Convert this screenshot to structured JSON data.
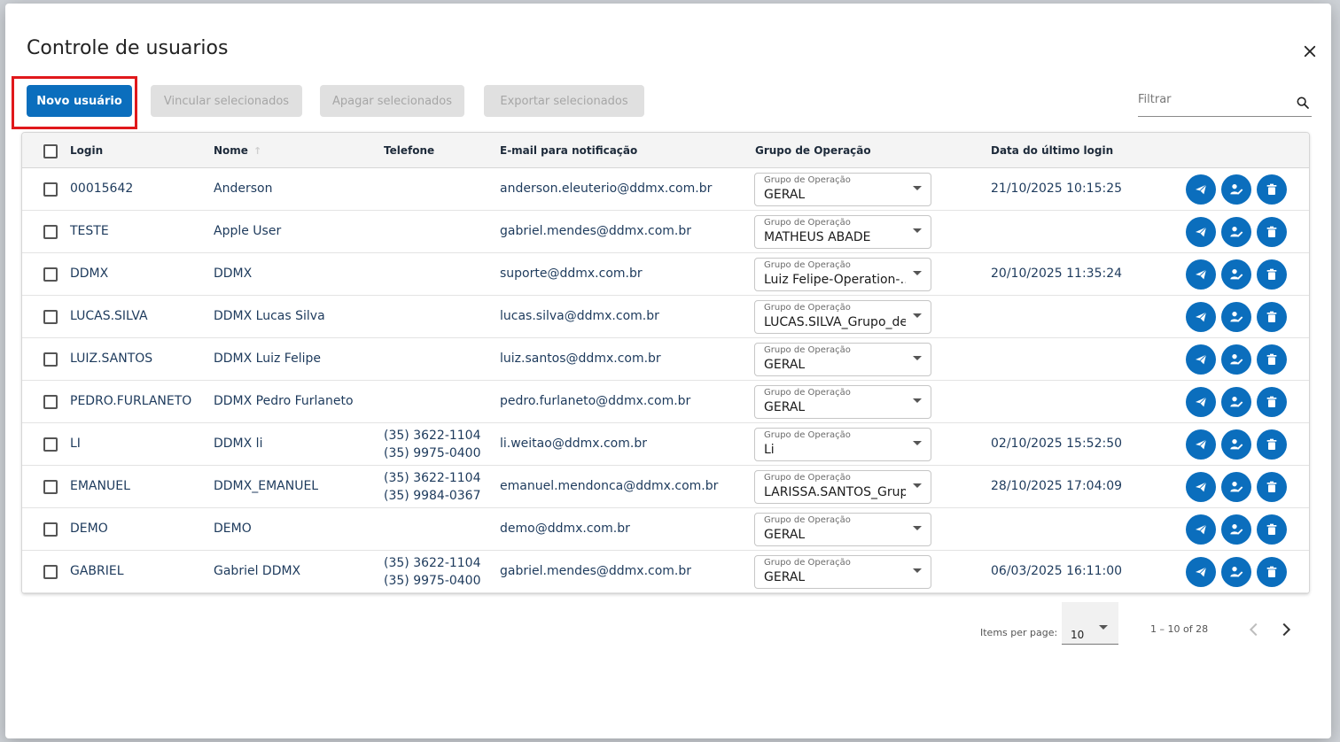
{
  "dialog": {
    "title": "Controle de usuarios"
  },
  "toolbar": {
    "new_user": "Novo usuário",
    "link_selected": "Vincular selecionados",
    "delete_selected": "Apagar selecionados",
    "export_selected": "Exportar selecionados"
  },
  "filter": {
    "placeholder": "Filtrar",
    "value": ""
  },
  "table": {
    "headers": {
      "login": "Login",
      "name": "Nome",
      "phone": "Telefone",
      "email": "E-mail para notificação",
      "group": "Grupo de Operação",
      "last_login": "Data do último login"
    },
    "group_field_label": "Grupo de Operação",
    "rows": [
      {
        "login": "00015642",
        "name": "Anderson",
        "phone1": "",
        "phone2": "",
        "email": "anderson.eleuterio@ddmx.com.br",
        "group": "GERAL",
        "last_login": "21/10/2025 10:15:25"
      },
      {
        "login": "TESTE",
        "name": "Apple User",
        "phone1": "",
        "phone2": "",
        "email": "gabriel.mendes@ddmx.com.br",
        "group": "MATHEUS ABADE",
        "last_login": ""
      },
      {
        "login": "DDMX",
        "name": "DDMX",
        "phone1": "",
        "phone2": "",
        "email": "suporte@ddmx.com.br",
        "group": "Luiz Felipe-Operation-…",
        "last_login": "20/10/2025 11:35:24"
      },
      {
        "login": "LUCAS.SILVA",
        "name": "DDMX Lucas Silva",
        "phone1": "",
        "phone2": "",
        "email": "lucas.silva@ddmx.com.br",
        "group": "LUCAS.SILVA_Grupo_de…",
        "last_login": ""
      },
      {
        "login": "LUIZ.SANTOS",
        "name": "DDMX Luiz Felipe",
        "phone1": "",
        "phone2": "",
        "email": "luiz.santos@ddmx.com.br",
        "group": "GERAL",
        "last_login": ""
      },
      {
        "login": "PEDRO.FURLANETO",
        "name": "DDMX Pedro Furlaneto",
        "phone1": "",
        "phone2": "",
        "email": "pedro.furlaneto@ddmx.com.br",
        "group": "GERAL",
        "last_login": ""
      },
      {
        "login": "LI",
        "name": "DDMX li",
        "phone1": "(35) 3622-1104",
        "phone2": "(35) 9975-0400",
        "email": "li.weitao@ddmx.com.br",
        "group": "Li",
        "last_login": "02/10/2025 15:52:50"
      },
      {
        "login": "EMANUEL",
        "name": "DDMX_EMANUEL",
        "phone1": "(35) 3622-1104",
        "phone2": "(35) 9984-0367",
        "email": "emanuel.mendonca@ddmx.com.br",
        "group": "LARISSA.SANTOS_Grup…",
        "last_login": "28/10/2025 17:04:09"
      },
      {
        "login": "DEMO",
        "name": "DEMO",
        "phone1": "",
        "phone2": "",
        "email": "demo@ddmx.com.br",
        "group": "GERAL",
        "last_login": ""
      },
      {
        "login": "GABRIEL",
        "name": "Gabriel DDMX",
        "phone1": "(35) 3622-1104",
        "phone2": "(35) 9975-0400",
        "email": "gabriel.mendes@ddmx.com.br",
        "group": "GERAL",
        "last_login": "06/03/2025 16:11:00"
      }
    ]
  },
  "paginator": {
    "items_per_page_label": "Items per page:",
    "page_size": "10",
    "range": "1 – 10 of 28"
  },
  "icons": {
    "close": "close-icon",
    "search": "search-icon",
    "send": "send-icon",
    "edit_user": "user-edit-icon",
    "delete": "trash-icon",
    "prev": "chevron-left-icon",
    "next": "chevron-right-icon"
  },
  "colors": {
    "primary": "#0b6ebd",
    "highlight": "#e0181b",
    "disabled_bg": "#e0e0e0"
  }
}
